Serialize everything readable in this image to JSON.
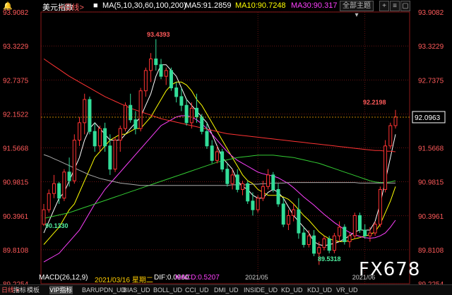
{
  "header": {
    "name": "美元指数",
    "period": "日线",
    "ma_label": "MA(5,10,30,60,100,200)",
    "ma5": "MA5:91.2859",
    "ma10": "MA10:90.7248",
    "ma30": "MA30:90.317",
    "btn_all": "全部主题",
    "colors": {
      "ma5": "#ffffff",
      "ma10": "#ffff00",
      "ma30": "#ff40ff",
      "ma60": "#33cc33",
      "ma100": "#aaaaaa",
      "ma200": "#ff3333"
    }
  },
  "chart_data": {
    "type": "candlestick",
    "y_ticks": [
      "93.9082",
      "93.3229",
      "92.7375",
      "92.1522",
      "91.5668",
      "90.9815",
      "90.3961",
      "89.8108",
      "89.2254"
    ],
    "y_range": [
      89.2254,
      93.9082
    ],
    "x_tick_labels": [
      "2021/05",
      "2021/06"
    ],
    "annotations": {
      "high": "93.4393",
      "low": "89.5318",
      "start_low": "90.1330",
      "recent_high": "92.2198",
      "last_price": "92.0963"
    },
    "candles": [
      [
        90.25,
        90.6,
        90.22,
        90.5
      ],
      [
        90.5,
        90.85,
        90.45,
        90.78
      ],
      [
        90.78,
        91.1,
        90.7,
        90.95
      ],
      [
        90.95,
        90.98,
        90.6,
        90.7
      ],
      [
        90.7,
        91.2,
        90.65,
        91.15
      ],
      [
        91.15,
        91.4,
        90.9,
        91.0
      ],
      [
        91.0,
        91.8,
        90.95,
        91.7
      ],
      [
        91.7,
        92.1,
        91.6,
        92.0
      ],
      [
        92.0,
        92.5,
        91.8,
        92.4
      ],
      [
        92.4,
        92.45,
        91.8,
        91.85
      ],
      [
        91.85,
        92.0,
        91.5,
        91.6
      ],
      [
        91.6,
        91.95,
        91.5,
        91.9
      ],
      [
        91.9,
        92.0,
        91.5,
        91.6
      ],
      [
        91.6,
        91.8,
        91.1,
        91.2
      ],
      [
        91.2,
        91.75,
        91.15,
        91.7
      ],
      [
        91.7,
        91.95,
        91.5,
        91.9
      ],
      [
        91.9,
        92.35,
        91.85,
        92.3
      ],
      [
        92.3,
        92.5,
        92.0,
        92.05
      ],
      [
        92.05,
        92.2,
        91.8,
        91.9
      ],
      [
        91.9,
        92.6,
        91.85,
        92.55
      ],
      [
        92.55,
        92.95,
        92.45,
        92.9
      ],
      [
        92.9,
        93.2,
        92.7,
        93.1
      ],
      [
        93.1,
        93.44,
        92.9,
        93.0
      ],
      [
        93.0,
        93.1,
        92.75,
        92.8
      ],
      [
        92.8,
        92.95,
        92.65,
        92.9
      ],
      [
        92.9,
        92.95,
        92.55,
        92.6
      ],
      [
        92.6,
        92.7,
        92.35,
        92.45
      ],
      [
        92.45,
        92.6,
        92.2,
        92.3
      ],
      [
        92.3,
        92.4,
        91.95,
        92.0
      ],
      [
        92.0,
        92.35,
        91.9,
        92.25
      ],
      [
        92.25,
        92.5,
        92.0,
        92.1
      ],
      [
        92.1,
        92.15,
        91.8,
        91.85
      ],
      [
        91.85,
        92.0,
        91.55,
        91.6
      ],
      [
        91.6,
        91.7,
        91.3,
        91.35
      ],
      [
        91.35,
        91.6,
        91.3,
        91.5
      ],
      [
        91.5,
        91.55,
        91.15,
        91.2
      ],
      [
        91.2,
        91.3,
        90.9,
        90.95
      ],
      [
        90.95,
        91.2,
        90.85,
        91.1
      ],
      [
        91.1,
        91.2,
        90.8,
        90.85
      ],
      [
        90.85,
        91.0,
        90.75,
        90.95
      ],
      [
        90.95,
        91.0,
        90.6,
        90.65
      ],
      [
        90.65,
        90.8,
        90.4,
        90.5
      ],
      [
        90.5,
        90.75,
        90.45,
        90.7
      ],
      [
        90.7,
        91.0,
        90.65,
        90.9
      ],
      [
        90.9,
        91.2,
        90.85,
        91.1
      ],
      [
        91.1,
        91.15,
        90.8,
        90.85
      ],
      [
        90.85,
        90.95,
        90.55,
        90.6
      ],
      [
        90.6,
        90.7,
        90.2,
        90.25
      ],
      [
        90.25,
        90.5,
        90.15,
        90.4
      ],
      [
        90.4,
        90.6,
        90.3,
        90.5
      ],
      [
        90.5,
        90.7,
        90.0,
        90.1
      ],
      [
        90.1,
        90.2,
        89.85,
        89.9
      ],
      [
        89.9,
        90.15,
        89.85,
        90.05
      ],
      [
        90.05,
        90.15,
        89.7,
        89.75
      ],
      [
        89.75,
        89.95,
        89.55,
        89.85
      ],
      [
        89.85,
        90.05,
        89.8,
        90.0
      ],
      [
        90.0,
        90.05,
        89.75,
        89.8
      ],
      [
        89.8,
        90.1,
        89.75,
        90.05
      ],
      [
        90.05,
        90.3,
        89.95,
        90.2
      ],
      [
        90.2,
        90.25,
        89.9,
        89.95
      ],
      [
        89.95,
        90.1,
        89.85,
        90.05
      ],
      [
        90.05,
        90.45,
        90.0,
        90.4
      ],
      [
        90.4,
        90.45,
        90.1,
        90.15
      ],
      [
        90.15,
        90.25,
        90.0,
        90.05
      ],
      [
        90.05,
        90.2,
        89.95,
        90.1
      ],
      [
        90.1,
        90.3,
        90.05,
        90.25
      ],
      [
        90.25,
        90.9,
        90.2,
        90.85
      ],
      [
        90.85,
        91.7,
        90.8,
        91.6
      ],
      [
        91.6,
        92.0,
        91.55,
        91.95
      ],
      [
        91.95,
        92.22,
        91.9,
        92.1
      ]
    ],
    "ma_series": [
      {
        "name": "MA5",
        "color": "#ffffff",
        "values": [
          90.1,
          90.3,
          90.5,
          90.7,
          90.8,
          91.0,
          91.2,
          91.4,
          91.7,
          91.9,
          92.0,
          91.9,
          91.8,
          91.7,
          91.7,
          91.7,
          91.8,
          91.9,
          92.0,
          92.1,
          92.3,
          92.5,
          92.8,
          93.0,
          93.0,
          92.9,
          92.8,
          92.6,
          92.4,
          92.3,
          92.2,
          92.1,
          92.0,
          91.8,
          91.6,
          91.4,
          91.3,
          91.2,
          91.0,
          90.9,
          90.85,
          90.75,
          90.7,
          90.7,
          90.8,
          90.85,
          90.8,
          90.7,
          90.55,
          90.4,
          90.3,
          90.2,
          90.1,
          89.95,
          89.9,
          89.88,
          89.9,
          89.92,
          89.95,
          90.0,
          90.05,
          90.12,
          90.15,
          90.15,
          90.15,
          90.3,
          90.6,
          91.0,
          91.4,
          91.8
        ]
      },
      {
        "name": "MA10",
        "color": "#ffff00",
        "values": [
          89.9,
          90.0,
          90.1,
          90.2,
          90.35,
          90.5,
          90.6,
          90.8,
          91.0,
          91.2,
          91.4,
          91.5,
          91.6,
          91.7,
          91.75,
          91.8,
          91.8,
          91.85,
          91.9,
          91.9,
          92.0,
          92.1,
          92.25,
          92.4,
          92.55,
          92.65,
          92.7,
          92.7,
          92.65,
          92.55,
          92.4,
          92.3,
          92.15,
          92.0,
          91.85,
          91.7,
          91.55,
          91.4,
          91.25,
          91.1,
          91.0,
          90.95,
          90.85,
          90.8,
          90.75,
          90.75,
          90.75,
          90.72,
          90.68,
          90.6,
          90.5,
          90.4,
          90.32,
          90.22,
          90.12,
          90.05,
          90.0,
          89.97,
          89.95,
          89.95,
          89.97,
          90.0,
          90.02,
          90.05,
          90.07,
          90.12,
          90.25,
          90.45,
          90.65,
          90.9
        ]
      },
      {
        "name": "MA30",
        "color": "#ff40ff",
        "values": [
          89.6,
          89.65,
          89.7,
          89.75,
          89.85,
          89.95,
          90.05,
          90.15,
          90.3,
          90.45,
          90.6,
          90.72,
          90.85,
          90.95,
          91.05,
          91.15,
          91.25,
          91.35,
          91.45,
          91.55,
          91.65,
          91.75,
          91.85,
          91.95,
          92.0,
          92.05,
          92.1,
          92.12,
          92.12,
          92.1,
          92.05,
          91.98,
          91.9,
          91.8,
          91.7,
          91.6,
          91.5,
          91.42,
          91.35,
          91.3,
          91.25,
          91.2,
          91.15,
          91.12,
          91.1,
          91.08,
          91.05,
          91.0,
          90.95,
          90.88,
          90.8,
          90.72,
          90.65,
          90.58,
          90.5,
          90.42,
          90.35,
          90.28,
          90.22,
          90.16,
          90.11,
          90.07,
          90.04,
          90.02,
          90.01,
          90.02,
          90.05,
          90.1,
          90.2,
          90.32
        ]
      },
      {
        "name": "MA60",
        "color": "#33cc33",
        "values": [
          90.35,
          90.37,
          90.39,
          90.41,
          90.43,
          90.45,
          90.48,
          90.51,
          90.54,
          90.57,
          90.6,
          90.63,
          90.66,
          90.69,
          90.72,
          90.75,
          90.78,
          90.81,
          90.84,
          90.87,
          90.9,
          90.93,
          90.96,
          90.99,
          91.02,
          91.05,
          91.08,
          91.11,
          91.14,
          91.17,
          91.2,
          91.23,
          91.26,
          91.29,
          91.32,
          91.34,
          91.36,
          91.38,
          91.4,
          91.41,
          91.42,
          91.43,
          91.44,
          91.44,
          91.44,
          91.44,
          91.43,
          91.42,
          91.41,
          91.4,
          91.38,
          91.36,
          91.34,
          91.32,
          91.3,
          91.27,
          91.24,
          91.21,
          91.18,
          91.15,
          91.12,
          91.09,
          91.06,
          91.03,
          91.0,
          90.98,
          90.97,
          90.97,
          90.98,
          91.0
        ]
      },
      {
        "name": "MA100",
        "color": "#aaaaaa",
        "values": [
          91.45,
          91.42,
          91.38,
          91.34,
          91.3,
          91.26,
          91.22,
          91.18,
          91.14,
          91.1,
          91.07,
          91.04,
          91.02,
          91.0,
          90.98,
          90.96,
          90.95,
          90.94,
          90.93,
          90.92,
          90.92,
          90.92,
          90.92,
          90.92,
          90.92,
          90.92,
          90.92,
          90.92,
          90.92,
          90.92,
          90.92,
          90.92,
          90.92,
          90.92,
          90.92,
          90.92,
          90.92,
          90.93,
          90.93,
          90.93,
          90.93,
          90.94,
          90.94,
          90.95,
          90.95,
          90.96,
          90.96,
          90.96,
          90.97,
          90.97,
          90.97,
          90.97,
          90.97,
          90.97,
          90.97,
          90.97,
          90.97,
          90.97,
          90.97,
          90.97,
          90.97,
          90.97,
          90.96,
          90.96,
          90.96,
          90.96,
          90.96,
          90.96,
          90.96,
          90.96
        ]
      },
      {
        "name": "MA200",
        "color": "#ff3333",
        "values": [
          93.1,
          93.04,
          92.98,
          92.92,
          92.86,
          92.8,
          92.75,
          92.7,
          92.65,
          92.6,
          92.55,
          92.5,
          92.45,
          92.41,
          92.37,
          92.33,
          92.29,
          92.25,
          92.22,
          92.19,
          92.16,
          92.13,
          92.1,
          92.07,
          92.05,
          92.03,
          92.01,
          91.99,
          91.97,
          91.95,
          91.93,
          91.91,
          91.89,
          91.87,
          91.85,
          91.83,
          91.81,
          91.8,
          91.79,
          91.78,
          91.77,
          91.76,
          91.75,
          91.74,
          91.73,
          91.72,
          91.71,
          91.7,
          91.69,
          91.68,
          91.67,
          91.66,
          91.65,
          91.64,
          91.63,
          91.62,
          91.61,
          91.6,
          91.59,
          91.58,
          91.57,
          91.56,
          91.55,
          91.54,
          91.53,
          91.52,
          91.52,
          91.51,
          91.51,
          91.5
        ]
      }
    ]
  },
  "macd": {
    "label": "MACD(26,12,9)",
    "date": "2021/03/16 星期二",
    "dif": "DIF:0.0960",
    "macd_val": "MACD:0.5207"
  },
  "watermark": "FX678",
  "bottom_tabs": {
    "period": "日线",
    "items": [
      "指标",
      "模板",
      "VIP指标",
      "BARUPDN_UD",
      "BIAS_UD",
      "BOLL_UD",
      "CCI_UD",
      "DMI_UD",
      "INSIDE_UD",
      "KD_UD",
      "KDJ_UD",
      "VR_UD"
    ]
  }
}
